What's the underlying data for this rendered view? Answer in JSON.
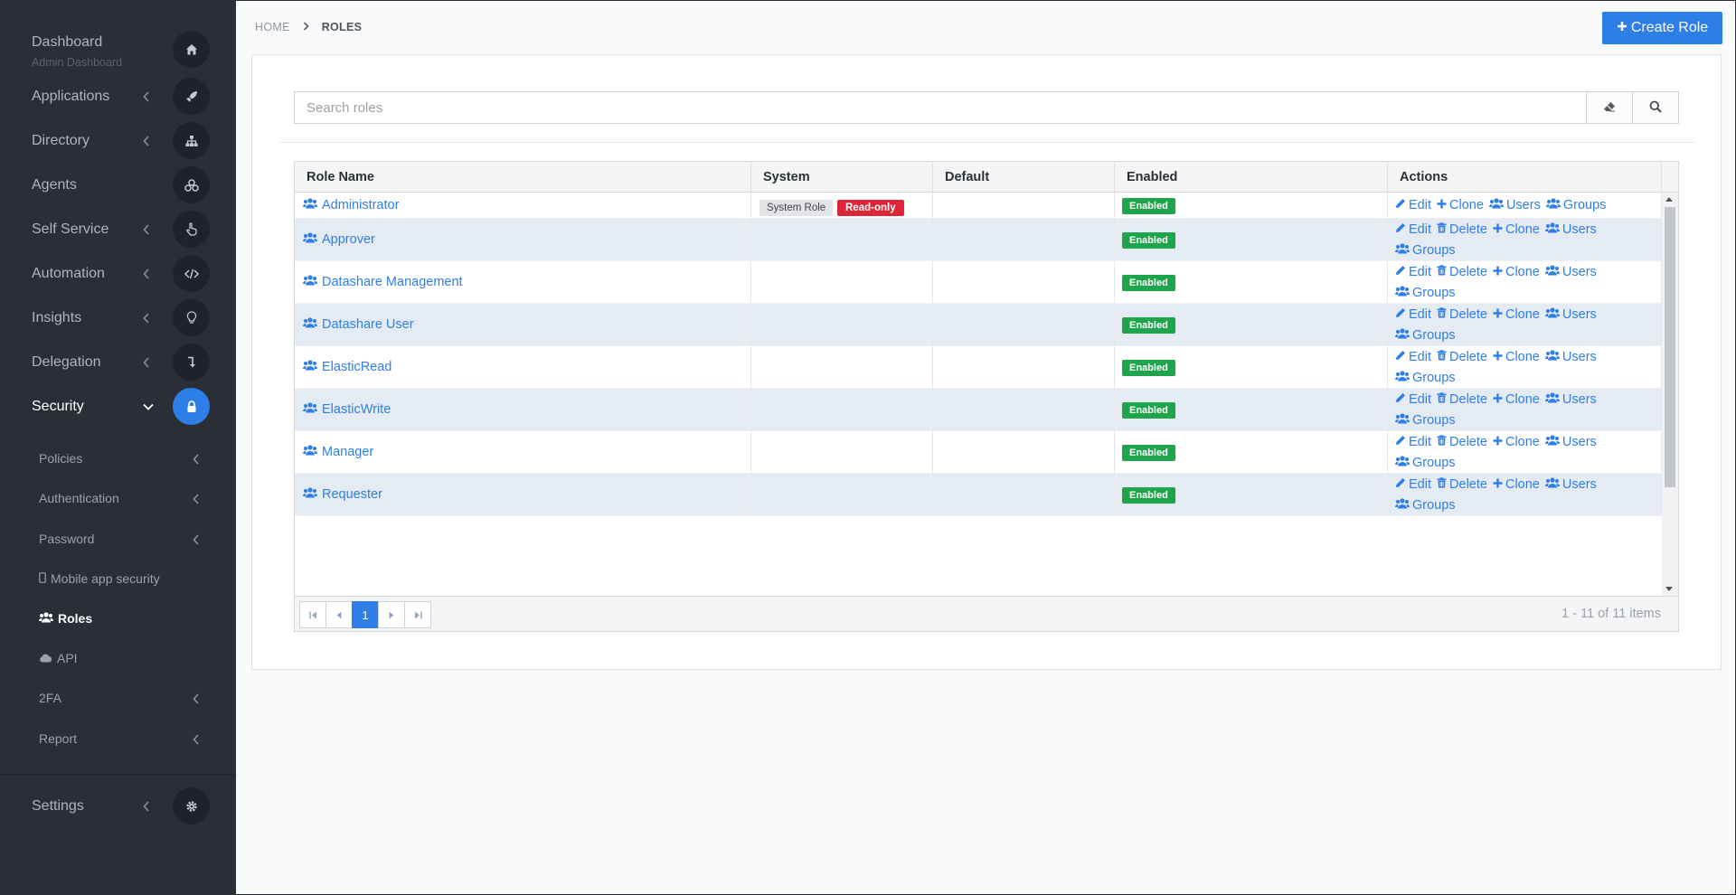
{
  "sidebar": {
    "items": [
      {
        "label": "Dashboard",
        "sublabel": "Admin Dashboard",
        "icon": "home-icon",
        "has_chevron": false
      },
      {
        "label": "Applications",
        "icon": "rocket-icon",
        "has_chevron": true
      },
      {
        "label": "Directory",
        "icon": "sitemap-icon",
        "has_chevron": true
      },
      {
        "label": "Agents",
        "icon": "agents-icon",
        "has_chevron": false
      },
      {
        "label": "Self Service",
        "icon": "hand-pointer-icon",
        "has_chevron": true
      },
      {
        "label": "Automation",
        "icon": "code-icon",
        "has_chevron": true
      },
      {
        "label": "Insights",
        "icon": "lightbulb-icon",
        "has_chevron": true
      },
      {
        "label": "Delegation",
        "icon": "level-down-icon",
        "has_chevron": true
      },
      {
        "label": "Security",
        "icon": "lock-icon",
        "has_chevron": true,
        "expanded": true
      }
    ],
    "security_sub": [
      {
        "label": "Policies",
        "has_chevron": true
      },
      {
        "label": "Authentication",
        "has_chevron": true
      },
      {
        "label": "Password",
        "has_chevron": true
      },
      {
        "label": "Mobile app security",
        "icon": "mobile-icon",
        "has_chevron": false
      },
      {
        "label": "Roles",
        "icon": "users-icon",
        "has_chevron": false,
        "active": true
      },
      {
        "label": "API",
        "icon": "cloud-icon",
        "has_chevron": false
      },
      {
        "label": "2FA",
        "has_chevron": true
      },
      {
        "label": "Report",
        "has_chevron": true
      }
    ],
    "settings": {
      "label": "Settings",
      "icon": "gear-icon"
    }
  },
  "breadcrumb": {
    "home": "HOME",
    "current": "ROLES"
  },
  "create_button": {
    "label": "Create Role"
  },
  "search": {
    "placeholder": "Search roles"
  },
  "table": {
    "columns": [
      "Role Name",
      "System",
      "Default",
      "Enabled",
      "Actions"
    ],
    "rows": [
      {
        "name": "Administrator",
        "system_badge": "System Role",
        "readonly_badge": "Read-only",
        "default": "",
        "enabled": "Enabled",
        "actions": [
          "Edit",
          "Clone",
          "Users",
          "Groups"
        ]
      },
      {
        "name": "Approver",
        "system_badge": "",
        "readonly_badge": "",
        "default": "",
        "enabled": "Enabled",
        "actions": [
          "Edit",
          "Delete",
          "Clone",
          "Users",
          "Groups"
        ]
      },
      {
        "name": "Datashare Management",
        "system_badge": "",
        "readonly_badge": "",
        "default": "",
        "enabled": "Enabled",
        "actions": [
          "Edit",
          "Delete",
          "Clone",
          "Users",
          "Groups"
        ]
      },
      {
        "name": "Datashare User",
        "system_badge": "",
        "readonly_badge": "",
        "default": "",
        "enabled": "Enabled",
        "actions": [
          "Edit",
          "Delete",
          "Clone",
          "Users",
          "Groups"
        ]
      },
      {
        "name": "ElasticRead",
        "system_badge": "",
        "readonly_badge": "",
        "default": "",
        "enabled": "Enabled",
        "actions": [
          "Edit",
          "Delete",
          "Clone",
          "Users",
          "Groups"
        ]
      },
      {
        "name": "ElasticWrite",
        "system_badge": "",
        "readonly_badge": "",
        "default": "",
        "enabled": "Enabled",
        "actions": [
          "Edit",
          "Delete",
          "Clone",
          "Users",
          "Groups"
        ]
      },
      {
        "name": "Manager",
        "system_badge": "",
        "readonly_badge": "",
        "default": "",
        "enabled": "Enabled",
        "actions": [
          "Edit",
          "Delete",
          "Clone",
          "Users",
          "Groups"
        ]
      },
      {
        "name": "Requester",
        "system_badge": "",
        "readonly_badge": "",
        "default": "",
        "enabled": "Enabled",
        "actions": [
          "Edit",
          "Delete",
          "Clone",
          "Users",
          "Groups"
        ]
      }
    ]
  },
  "pagination": {
    "current_page": "1",
    "info": "1 - 11 of 11 items"
  },
  "colors": {
    "sidebar_bg": "#2a2f37",
    "accent": "#2e7ee8",
    "enabled": "#1ea54c",
    "readonly": "#dc2637",
    "row_alt": "#e5ebf3"
  }
}
